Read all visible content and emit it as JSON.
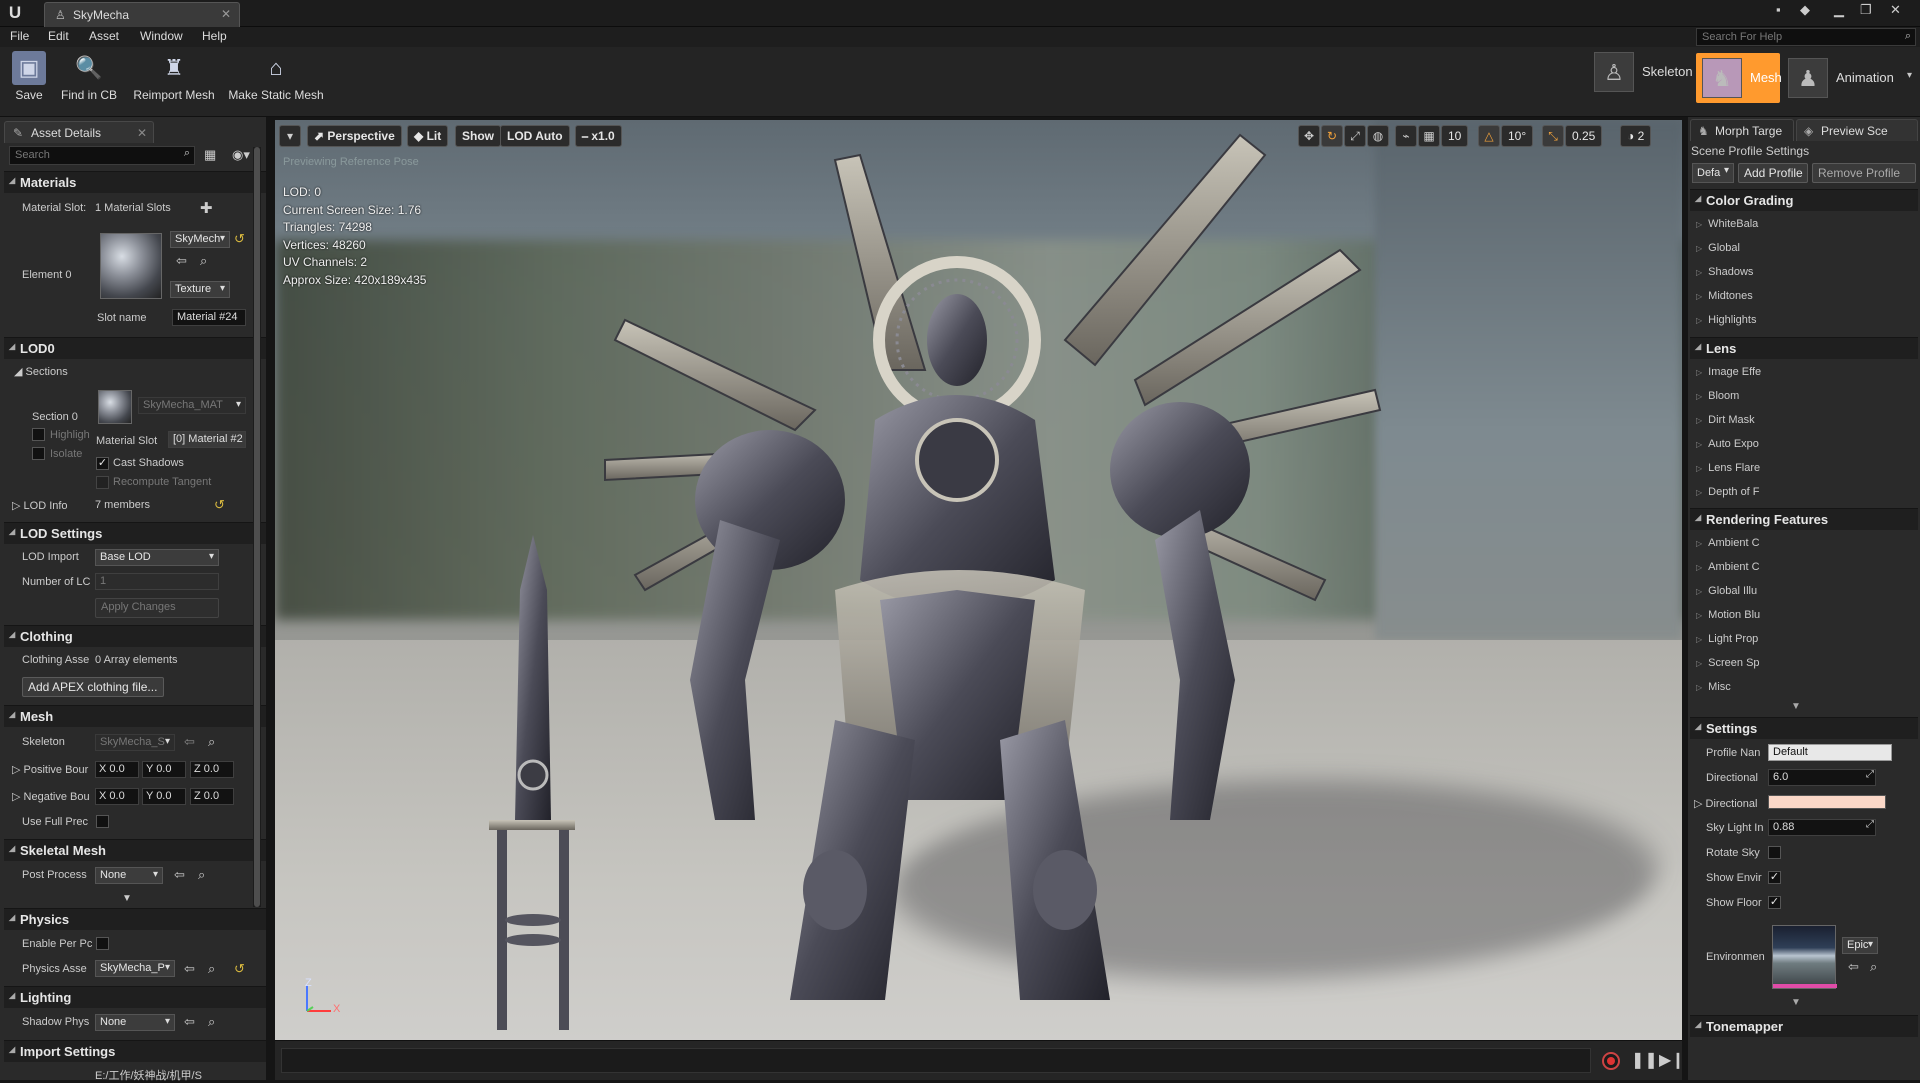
{
  "app": {
    "tab_title": "SkyMecha",
    "logo": "U"
  },
  "menu": [
    "File",
    "Edit",
    "Asset",
    "Window",
    "Help"
  ],
  "help_search": {
    "placeholder": "Search For Help"
  },
  "toolbar": {
    "buttons": [
      {
        "label": "Save",
        "icon": "save-icon"
      },
      {
        "label": "Find in CB",
        "icon": "find-in-content-browser-icon"
      },
      {
        "label": "Reimport Mesh",
        "icon": "reimport-icon"
      },
      {
        "label": "Make Static Mesh",
        "icon": "make-static-mesh-icon"
      }
    ],
    "modes": [
      {
        "label": "Skeleton",
        "active": false
      },
      {
        "label": "Mesh",
        "active": true
      },
      {
        "label": "Animation",
        "active": false
      }
    ],
    "accent_color": "#ff9a2e"
  },
  "asset_details": {
    "tab_label": "Asset Details",
    "search_placeholder": "Search",
    "materials": {
      "header": "Materials",
      "material_slots_label": "Material Slot:",
      "material_slots_value": "1 Material Slots",
      "element_label": "Element 0",
      "material_name": "SkyMech",
      "texture_combo": "Texture",
      "slot_name_label": "Slot name",
      "slot_name_value": "Material #24"
    },
    "lod0": {
      "header": "LOD0",
      "sections_label": "Sections",
      "section_label": "Section 0",
      "highlight_label": "Highligh",
      "isolate_label": "Isolate",
      "material_combo": "SkyMecha_MAT",
      "material_slot_label": "Material Slot",
      "material_slot_value": "[0] Material #2",
      "cast_shadows_label": "Cast Shadows",
      "cast_shadows_checked": true,
      "recompute_tangent_label": "Recompute Tangent",
      "lod_info_label": "LOD Info",
      "lod_info_value": "7 members"
    },
    "lod_settings": {
      "header": "LOD Settings",
      "lod_import_label": "LOD Import",
      "lod_import_value": "Base LOD",
      "number_of_lods_label": "Number of LC",
      "number_of_lods_value": "1",
      "apply_button": "Apply Changes"
    },
    "clothing": {
      "header": "Clothing",
      "assets_label": "Clothing Asse",
      "assets_value": "0 Array elements",
      "add_button": "Add APEX clothing file..."
    },
    "mesh": {
      "header": "Mesh",
      "skeleton_label": "Skeleton",
      "skeleton_value": "SkyMecha_S",
      "positive_bounds_label": "Positive Bour",
      "negative_bounds_label": "Negative Bou",
      "x_value": "X 0.0",
      "y_value": "Y 0.0",
      "z_value": "Z 0.0",
      "use_full_precision_label": "Use Full Prec"
    },
    "skeletal_mesh": {
      "header": "Skeletal Mesh",
      "post_process_label": "Post Process",
      "post_process_value": "None"
    },
    "physics": {
      "header": "Physics",
      "enable_per_poly_label": "Enable Per Pc",
      "physics_asset_label": "Physics Asse",
      "physics_asset_value": "SkyMecha_P"
    },
    "lighting": {
      "header": "Lighting",
      "shadow_physics_label": "Shadow Phys",
      "shadow_physics_value": "None"
    },
    "import_settings": {
      "header": "Import Settings",
      "path_value": "E:/工作/妖神战/机甲/S"
    }
  },
  "viewport": {
    "toolbar": {
      "perspective": "Perspective",
      "lit": "Lit",
      "show": "Show",
      "lod": "LOD Auto",
      "speed": "x1.0",
      "grid_snap": "10",
      "rotation_snap": "10°",
      "scale_snap": "0.25",
      "camera_speed": "2"
    },
    "preview_note": "Previewing Reference Pose",
    "stats": [
      "LOD: 0",
      "Current Screen Size: 1.76",
      "Triangles: 74298",
      "Vertices: 48260",
      "UV Channels: 2",
      "Approx Size: 420x189x435"
    ],
    "axis": {
      "z": "Z",
      "x": "X"
    }
  },
  "preview_panel": {
    "tabs": [
      "Morph Targe",
      "Preview Sce"
    ],
    "scene_profile_header": "Scene Profile Settings",
    "profile_combo": "Defa",
    "add_profile": "Add Profile",
    "remove_profile": "Remove Profile",
    "color_grading": {
      "header": "Color Grading",
      "items": [
        "WhiteBala",
        "Global",
        "Shadows",
        "Midtones",
        "Highlights"
      ]
    },
    "lens": {
      "header": "Lens",
      "items": [
        "Image Effe",
        "Bloom",
        "Dirt Mask",
        "Auto Expo",
        "Lens Flare",
        "Depth of F"
      ]
    },
    "rendering_features": {
      "header": "Rendering Features",
      "items": [
        "Ambient C",
        "Ambient C",
        "Global Illu",
        "Motion Blu",
        "Light Prop",
        "Screen Sp",
        "Misc"
      ]
    },
    "settings": {
      "header": "Settings",
      "profile_name_label": "Profile Nan",
      "profile_name_value": "Default",
      "directional_label": "Directional",
      "directional_value": "6.0",
      "directional_color_label": "Directional",
      "directional_color": "#fbd8c8",
      "sky_light_label": "Sky Light In",
      "sky_light_value": "0.88",
      "rotate_sky_label": "Rotate Sky",
      "rotate_sky_checked": false,
      "show_env_label": "Show Envir",
      "show_env_checked": true,
      "show_floor_label": "Show Floor",
      "show_floor_checked": true,
      "environment_label": "Environmen",
      "environment_combo": "Epic"
    },
    "tonemapper": {
      "header": "Tonemapper"
    }
  }
}
